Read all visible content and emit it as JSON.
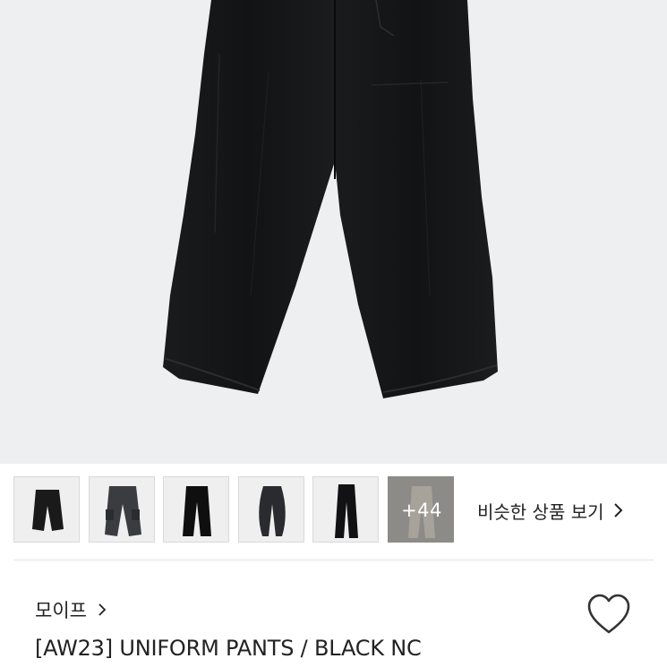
{
  "product_image": {
    "alt": ""
  },
  "thumbnails": [
    {
      "icon": "cropped-wide-pants"
    },
    {
      "icon": "cargo-pants"
    },
    {
      "icon": "straight-pants"
    },
    {
      "icon": "balloon-pants"
    },
    {
      "icon": "slim-straight-pants"
    },
    {
      "icon": "beige-pants",
      "more_label": "+44"
    }
  ],
  "similar_products": {
    "label": "비슷한 상품 보기",
    "icon": "chevron-right-icon"
  },
  "shop": {
    "name": "모이프",
    "icon": "chevron-right-icon"
  },
  "product": {
    "title": "[AW23] UNIFORM PANTS / BLACK NC"
  },
  "wishlist": {
    "icon": "heart-icon"
  },
  "colors": {
    "hero_bg": "#eeeff1",
    "garment": "#161718",
    "more_overlay": "#8c8b88"
  }
}
